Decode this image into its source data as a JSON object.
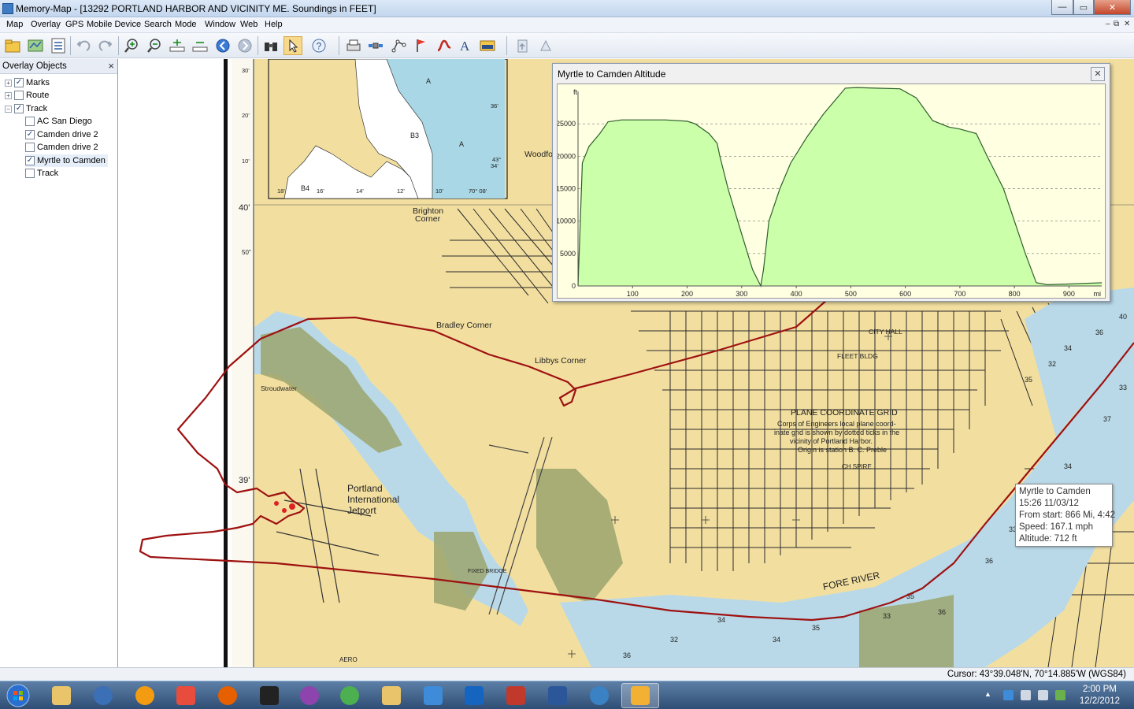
{
  "window": {
    "title": "Memory-Map - [13292 PORTLAND HARBOR AND VICINITY  ME. Soundings in FEET]",
    "min_label": "—",
    "max_label": "▭",
    "close_label": "✕"
  },
  "menu": {
    "items": [
      "Map",
      "Overlay",
      "GPS",
      "Mobile Device",
      "Search",
      "Mode",
      "Window",
      "Web",
      "Help"
    ],
    "mdi_min": "–",
    "mdi_restore": "⧉",
    "mdi_close": "✕"
  },
  "sidebar": {
    "title": "Overlay Objects",
    "close": "×",
    "items": [
      {
        "label": "Marks",
        "checked": true,
        "expander": "+"
      },
      {
        "label": "Route",
        "checked": false,
        "expander": "+"
      },
      {
        "label": "Track",
        "checked": true,
        "expander": "−"
      },
      {
        "label": "AC San Diego",
        "checked": false
      },
      {
        "label": "Camden drive 2",
        "checked": true
      },
      {
        "label": "Camden drive 2",
        "checked": false
      },
      {
        "label": "Myrtle to Camden",
        "checked": true,
        "selected": true
      },
      {
        "label": "Track",
        "checked": false
      }
    ]
  },
  "map": {
    "labels": {
      "brighton": "Brighton",
      "corner": "Corner",
      "bradley": "Bradley Corner",
      "libbys": "Libbys Corner",
      "portland": "Portland",
      "international": "International",
      "jetport": "Jetport",
      "city_hall": "CITY HALL",
      "fleet_bldg": "FLEET BLDG",
      "grid_title": "PLANE COORDINATE GRID",
      "grid_l1": "Corps of Engineers local plane coord-",
      "grid_l2": "inate grid is shown by dotted ticks in the",
      "grid_l3": "vicinity of Portland Harbor.",
      "grid_l4": "Origin is station B. C. Preble",
      "fore_river": "FORE RIVER",
      "woodfo": "Woodfo",
      "stroudwater": "Stroudwater",
      "ch_spire": "CH SPIRE",
      "fixed_bridge": "FIXED BRIDGE",
      "aero": "AERO",
      "lat_40": "40'",
      "lat_50": "50\"",
      "lat_39": "39'",
      "inset_30": "30'",
      "inset_20": "20'",
      "inset_10": "10'",
      "inset_a1": "A",
      "inset_a2": "A",
      "inset_b3": "B3",
      "inset_b4": "B4",
      "inset_36": "36'",
      "inset_43": "43°",
      "inset_34": "34'",
      "inset_18": "18'",
      "inset_16": "16'",
      "inset_14": "14'",
      "inset_12": "12'",
      "inset_10b": "10'",
      "inset_70": "70° 08'"
    }
  },
  "altitude_panel": {
    "title": "Myrtle to Camden Altitude",
    "close": "✕"
  },
  "chart_data": {
    "type": "area",
    "title": "Myrtle to Camden Altitude",
    "ylabel": "ft",
    "xlabel": "mi",
    "xlim": [
      0,
      960
    ],
    "ylim": [
      0,
      30000
    ],
    "x_ticks": [
      100,
      200,
      300,
      400,
      500,
      600,
      700,
      800,
      900
    ],
    "y_ticks": [
      0,
      5000,
      10000,
      15000,
      20000,
      25000
    ],
    "grid": true,
    "fill_color": "#ccffaa",
    "line_color": "#2e5e2e",
    "x": [
      0,
      8,
      20,
      40,
      55,
      80,
      120,
      160,
      200,
      215,
      240,
      255,
      260,
      275,
      300,
      320,
      335,
      340,
      350,
      370,
      390,
      420,
      450,
      490,
      510,
      545,
      590,
      620,
      650,
      680,
      700,
      730,
      750,
      780,
      800,
      820,
      840,
      860,
      900,
      960
    ],
    "y": [
      0,
      19000,
      21500,
      23500,
      25300,
      25600,
      25600,
      25600,
      25400,
      25000,
      23500,
      22000,
      20000,
      15000,
      8000,
      2500,
      0,
      2500,
      10000,
      15000,
      19000,
      23000,
      26500,
      30500,
      30600,
      30500,
      30400,
      29000,
      25500,
      24500,
      24200,
      23500,
      20000,
      15000,
      10000,
      5000,
      500,
      200,
      300,
      500
    ]
  },
  "tooltip": {
    "name": "Myrtle to Camden",
    "time": "15:26 11/03/12",
    "from_start": "From start: 866 Mi, 4:42",
    "speed": "Speed: 167.1 mph",
    "altitude": "Altitude: 712 ft"
  },
  "status": {
    "cursor": "Cursor: 43°39.048'N, 70°14.885'W (WGS84)"
  },
  "taskbar": {
    "time": "2:00 PM",
    "date": "12/2/2012",
    "colors": {
      "start": "#2a6fd0",
      "folder": "#e9c46a",
      "hp": "#3b6fb6",
      "vlc": "#f39c12",
      "hub": "#e74c3c",
      "firefox": "#e66000",
      "warn": "#222222",
      "picasa": "#8e44ad",
      "chrome": "#4caf50",
      "pics": "#3d8bd9",
      "remote": "#1565c0",
      "q": "#c0392b",
      "word": "#2b579a",
      "itunes": "#3b82c4",
      "mm": "#f2b134"
    }
  }
}
